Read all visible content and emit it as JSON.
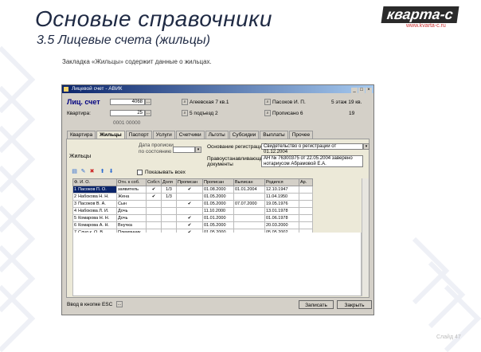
{
  "slide": {
    "title": "Основые справочники",
    "subtitle": "3.5  Лицевые счета (жильцы)",
    "description": "Закладка «Жильцы» содержит данные о жильцах.",
    "logo_brand": "кварта-с",
    "logo_site": "www.kvarta-c.ru",
    "page_number": "Слайд 47"
  },
  "window": {
    "title": "Лицевой счет - АВИК",
    "header": {
      "account_label": "Лиц. счет",
      "account_value": "4068",
      "apartment_label": "Квартира:",
      "apartment_value": "25",
      "id_value": "0001 00000",
      "street_value": "Агеевская 7 кв.1",
      "district_value": "5 подъезд 2",
      "owner_value": "Пасоков И. П.",
      "purpose_value": "Прописано 6",
      "right_note1": "5 этаж  19 кв.",
      "right_note2": "19"
    },
    "tabs": [
      "Квартира",
      "Жильцы",
      "Паспорт",
      "Услуги",
      "Счетчики",
      "Льготы",
      "Субсидии",
      "Выплаты",
      "Прочее"
    ],
    "active_tab": "Жильцы",
    "residents_panel": {
      "section_label": "Жильцы",
      "date_label": "Дата прописки",
      "date_label2": "по состоянию",
      "date_value": "",
      "relation_label": "Основание регистрации",
      "relation_value": "Свидетельство о регистрации от 01.12.2004",
      "doc_label": "Правоустанавливающие",
      "doc_label2": "документы",
      "doc_value1": "АН № 76300375 от 22.05.2004 заверено",
      "doc_value2": "нотариусом Абрамовой Е.А.",
      "show_all_label": "Показывать всех"
    },
    "grid": {
      "columns": [
        "Ф. И. О.",
        "Отн. к соб.",
        "Собст.",
        "Доля",
        "Прописан",
        "Прописан",
        "Выписан",
        "Родился",
        "Ар."
      ],
      "rows": [
        {
          "num": "1",
          "name": "Пасоков П. О.",
          "rel": "заявитель",
          "own": "✔",
          "share": "1/3",
          "prop": "✔",
          "from": "01.08.2000",
          "out": "01.01.2004",
          "born": "12.10.1947",
          "sel": true
        },
        {
          "num": "2",
          "name": "Набокова Н. Н.",
          "rel": "Жена",
          "own": "✔",
          "share": "1/3",
          "prop": "",
          "from": "01.05.2000",
          "out": "",
          "born": "11.04.1950",
          "sel": false
        },
        {
          "num": "3",
          "name": "Пасоков В. А.",
          "rel": "Сын",
          "own": "",
          "share": "",
          "prop": "✔",
          "from": "01.05.2000",
          "out": "07.07.2000",
          "born": "19.05.1976",
          "sel": false
        },
        {
          "num": "4",
          "name": "Набокова Л. И.",
          "rel": "Дочь",
          "own": "",
          "share": "",
          "prop": "",
          "from": "11.10.2000",
          "out": "",
          "born": "13.01.1978",
          "sel": false
        },
        {
          "num": "5",
          "name": "Комарова Н. Н.",
          "rel": "Дочь",
          "own": "",
          "share": "",
          "prop": "✔",
          "from": "01.01.2000",
          "out": "",
          "born": "01.06.1978",
          "sel": false
        },
        {
          "num": "6",
          "name": "Комарова А. Н.",
          "rel": "Внучка",
          "own": "",
          "share": "",
          "prop": "✔",
          "from": "01.05.2000",
          "out": "",
          "born": "20.03.2000",
          "sel": false
        },
        {
          "num": "7",
          "name": "Слуд к. О. В.",
          "rel": "Племянник",
          "own": "",
          "share": "",
          "prop": "✔",
          "from": "01.05.2000",
          "out": "",
          "born": "05.05.2002",
          "sel": false
        }
      ]
    },
    "footer": {
      "status": "Ввод в кнопке ESC",
      "save_label": "Записать",
      "close_label": "Закрыть"
    }
  }
}
